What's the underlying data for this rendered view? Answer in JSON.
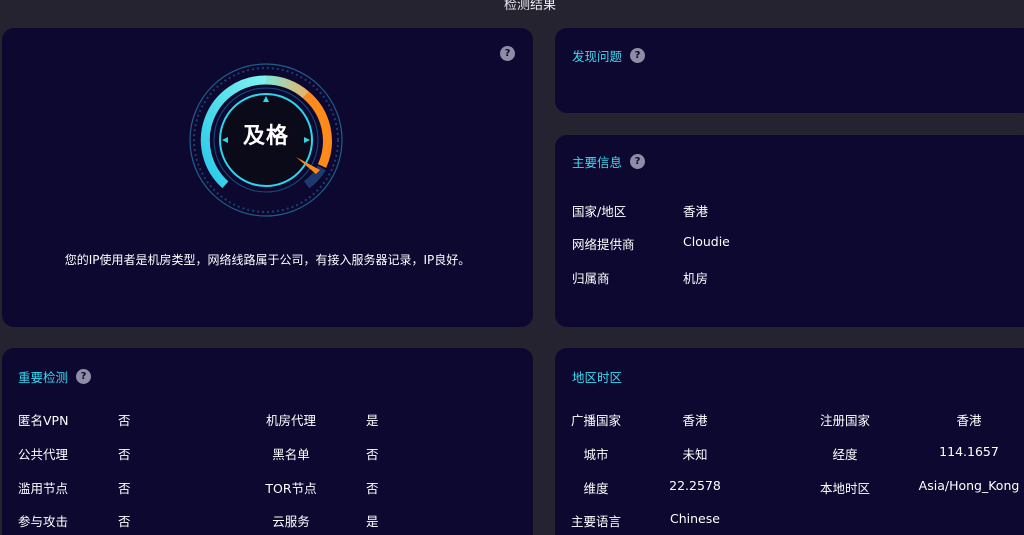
{
  "page": {
    "title": "检测结果"
  },
  "score": {
    "label": "及格",
    "summary": "您的IP使用者是机房类型，网络线路属于公司，有接入服务器记录，IP良好。",
    "help": "?"
  },
  "issues": {
    "title": "发现问题",
    "help": "?"
  },
  "main_info": {
    "title": "主要信息",
    "help": "?",
    "rows": [
      {
        "label": "国家/地区",
        "value": "香港"
      },
      {
        "label": "网络提供商",
        "value": "Cloudie"
      },
      {
        "label": "归属商",
        "value": "机房"
      }
    ]
  },
  "checks": {
    "title": "重要检测",
    "help": "?",
    "rows": [
      {
        "l1": "匿名VPN",
        "v1": "否",
        "l2": "机房代理",
        "v2": "是"
      },
      {
        "l1": "公共代理",
        "v1": "否",
        "l2": "黑名单",
        "v2": "否"
      },
      {
        "l1": "滥用节点",
        "v1": "否",
        "l2": "TOR节点",
        "v2": "否"
      },
      {
        "l1": "参与攻击",
        "v1": "否",
        "l2": "云服务",
        "v2": "是"
      }
    ]
  },
  "region": {
    "title": "地区时区",
    "rows": [
      {
        "l1": "广播国家",
        "v1": "香港",
        "l2": "注册国家",
        "v2": "香港"
      },
      {
        "l1": "城市",
        "v1": "未知",
        "l2": "经度",
        "v2": "114.1657"
      },
      {
        "l1": "维度",
        "v1": "22.2578",
        "l2": "本地时区",
        "v2": "Asia/Hong_Kong"
      },
      {
        "l1": "主要语言",
        "v1": "Chinese"
      }
    ]
  },
  "colors": {
    "background": "#24232f",
    "card": "#0c0830",
    "accent": "#3fd6ee",
    "gauge_orange": "#ff8a1c",
    "gauge_cyan": "#3ee8f2"
  }
}
